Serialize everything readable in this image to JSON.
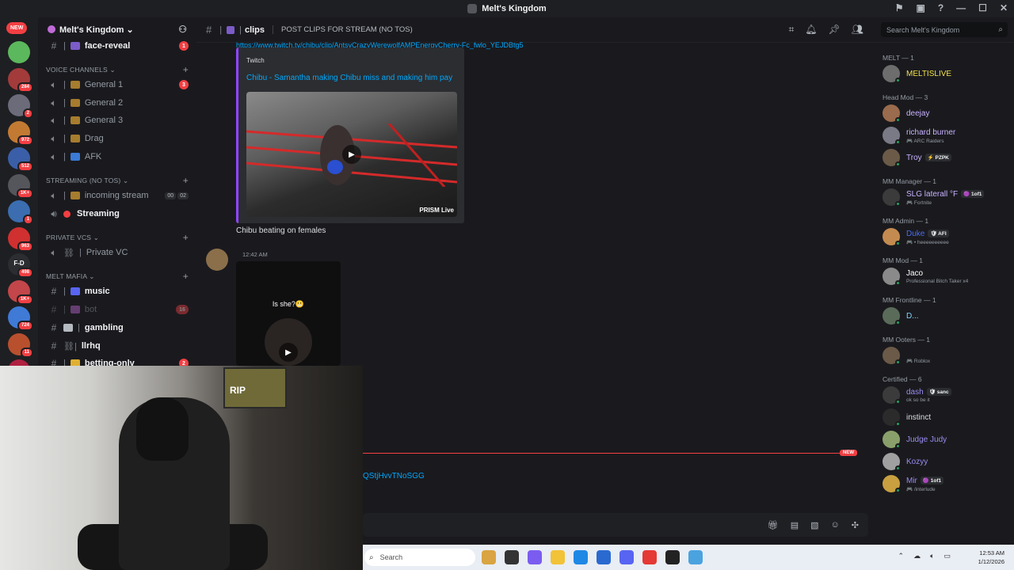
{
  "window": {
    "title": "Melt's Kingdom",
    "controls": [
      "—",
      "☐",
      "✕"
    ]
  },
  "servers": {
    "new_label": "NEW",
    "items": [
      {
        "color": "#5cb85c",
        "badge": ""
      },
      {
        "color": "#a33b3b",
        "badge": "284"
      },
      {
        "color": "#6b6b7a",
        "badge": "2"
      },
      {
        "color": "#c27a33",
        "badge": "972"
      },
      {
        "color": "#3a5fa8",
        "badge": "512"
      },
      {
        "color": "#55565c",
        "badge": "1K+"
      },
      {
        "color": "#3b6db0",
        "badge": "1"
      },
      {
        "color": "#d03030",
        "badge": "963"
      },
      {
        "color": "#2b2d31",
        "badge": "498",
        "text": "F-D"
      },
      {
        "color": "#c2464a",
        "badge": "1K+"
      },
      {
        "color": "#3f7ad6",
        "badge": "724"
      },
      {
        "color": "#b8502e",
        "badge": "11"
      },
      {
        "color": "#b02040",
        "badge": ""
      }
    ]
  },
  "guild": {
    "name": "Melt's Kingdom ⌄"
  },
  "channels": {
    "top_channel": {
      "label": "face-reveal",
      "badge": "1"
    },
    "voice_header": "VOICE CHANNELS ⌄",
    "voice": [
      {
        "label": "General 1",
        "badge": "3"
      },
      {
        "label": "General 2"
      },
      {
        "label": "General 3"
      },
      {
        "label": "Drag"
      },
      {
        "label": "AFK"
      }
    ],
    "streaming_header": "STREAMING (NO TOS) ⌄",
    "streaming": [
      {
        "label": "incoming stream",
        "count_a": "00",
        "count_b": "02"
      },
      {
        "label": "Streaming"
      }
    ],
    "private_header": "PRIVATE VCS ⌄",
    "private": [
      {
        "label": "Private VC"
      }
    ],
    "mafia_header": "MELT MAFIA ⌄",
    "mafia": [
      {
        "label": "music"
      },
      {
        "label": "bot",
        "badge": "16"
      },
      {
        "label": "gambling"
      },
      {
        "label": "llrhq"
      },
      {
        "label": "betting-only",
        "badge": "2"
      }
    ]
  },
  "topbar": {
    "channel": "clips",
    "topic": "POST CLIPS FOR STREAM (NO TOS)",
    "search_placeholder": "Search Melt's Kingdom"
  },
  "chat": {
    "link_top": "https://www.twitch.tv/chibu/clip/AntsyCrazyWerewolfAMPEnergyCherry-Fc_fwlo_YEJDBtg5",
    "embed": {
      "provider": "Twitch",
      "title": "Chibu - Samantha making Chibu miss and making him pay",
      "watermark": "PRISM Live"
    },
    "message_text": "Chibu beating on females",
    "second_time": "12:42 AM",
    "video_caption": "Is she?😬",
    "new_label": "NEW",
    "link_bottom": "QStjHvvTNoSGG"
  },
  "members": {
    "groups": [
      {
        "title": "MELT — 1",
        "members": [
          {
            "name": "MELTISLIVE",
            "color": "#f0e04a",
            "avatar": "#6d6d6d"
          }
        ]
      },
      {
        "title": "Head Mod — 3",
        "members": [
          {
            "name": "deejay",
            "color": "#c9b2ff",
            "avatar": "#9b6b4d"
          },
          {
            "name": "richard burner",
            "sub": "🎮 ARC Raiders",
            "color": "#c9b2ff",
            "avatar": "#7a7a86"
          },
          {
            "name": "Troy",
            "tag": "⚡ PZPK",
            "color": "#c9b2ff",
            "avatar": "#6b5a48"
          }
        ]
      },
      {
        "title": "MM Manager — 1",
        "members": [
          {
            "name": "SLG laterall °F",
            "tag": "🟣 1of1",
            "sub": "🎮 Fortnite",
            "color": "#c9b2ff",
            "avatar": "#3b3b3b"
          }
        ]
      },
      {
        "title": "MM Admin — 1",
        "members": [
          {
            "name": "Duke",
            "tag": "🛡 AFI",
            "sub": "🎮 • heeeeeeeeee",
            "color": "#4b6cf0",
            "avatar": "#c48b50"
          }
        ]
      },
      {
        "title": "MM Mod — 1",
        "members": [
          {
            "name": "Jaco",
            "sub": "Professional Bitch Taker x4",
            "color": "#ffffff",
            "avatar": "#8a8a8a"
          }
        ]
      },
      {
        "title": "MM Frontline — 1",
        "members": [
          {
            "name": "D...",
            "color": "#7fd4ff",
            "avatar": "#5a6b5a"
          }
        ]
      },
      {
        "title": "MM Ooters — 1",
        "members": [
          {
            "name": "",
            "sub": "🎮 Roblox",
            "color": "#dbdee1",
            "avatar": "#6b5a48"
          }
        ]
      },
      {
        "title": "Certified — 6",
        "members": [
          {
            "name": "dash",
            "tag": "🛡 sanc",
            "sub": "ok so be it",
            "color": "#9a8cf0",
            "avatar": "#3b3b3b"
          },
          {
            "name": "instinct",
            "color": "#dbdee1",
            "avatar": "#2b2b2b"
          },
          {
            "name": "Judge Judy",
            "color": "#9a8cf0",
            "avatar": "#8aa06b"
          },
          {
            "name": "Kozyy",
            "color": "#9a8cf0",
            "avatar": "#a0a0a0"
          },
          {
            "name": "Mir",
            "tag": "🟣 1of1",
            "sub": "🎮 /interlude",
            "color": "#9a8cf0",
            "avatar": "#c9a040"
          }
        ]
      }
    ]
  },
  "webcam": {
    "poster_text": "RIP"
  },
  "taskbar": {
    "search_label": "Search",
    "apps": [
      "#d9a441",
      "#333333",
      "#7b5cf0",
      "#f2c237",
      "#1e88e5",
      "#2a6ad0",
      "#5865f2",
      "#e53935",
      "#222222",
      "#4aa3df"
    ],
    "time": "12:53 AM",
    "date": "1/12/2026"
  }
}
